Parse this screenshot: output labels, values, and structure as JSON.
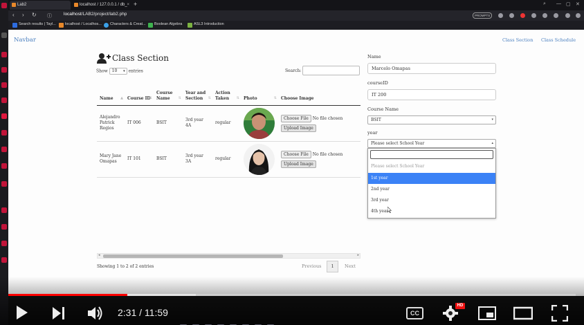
{
  "browser": {
    "tabs": [
      {
        "label": "Lab2",
        "active": true
      },
      {
        "label": "localhost / 127.0.0.1 / db_",
        "active": false
      }
    ],
    "url_host": "localhost",
    "url_path": "/LAB2/project/lab2.php",
    "bookmarks": [
      {
        "label": "Search results | Tayl...",
        "color": "#2d6cdf"
      },
      {
        "label": "localhost / Localhos...",
        "color": "#e8882a"
      },
      {
        "label": "Characters & Creat...",
        "color": "#3aa0e8"
      },
      {
        "label": "Boolean Algebra",
        "color": "#3fb34f"
      },
      {
        "label": "ASL3 Introduction",
        "color": "#7cb342"
      }
    ],
    "promo_badge": "PROMPTS"
  },
  "navbar": {
    "brand": "Navbar",
    "links": [
      "Class Section",
      "Class Schedule"
    ]
  },
  "section": {
    "title": "Class Section",
    "icon": "user-plus-icon",
    "show_label": "Show",
    "entries_value": "10",
    "entries_label": "entries",
    "search_label": "Search:"
  },
  "table": {
    "columns": [
      "Name",
      "Course ID",
      "Course Name",
      "Year and Section",
      "Action Taken",
      "Photo",
      "Choose Image"
    ],
    "rows": [
      {
        "name": "Alejandro Patrick Regios",
        "course_id": "IT 006",
        "course_name": "BSIT",
        "year_section": "3rd year 4A",
        "action": "regular"
      },
      {
        "name": "Mary Jane Omapas",
        "course_id": "IT 101",
        "course_name": "BSIT",
        "year_section": "3rd year 3A",
        "action": "regular"
      }
    ],
    "choose_file_label": "Choose File",
    "no_file_label": "No file chosen",
    "upload_label": "Upload Image",
    "info": "Showing 1 to 2 of 2 entries",
    "pagination": {
      "previous": "Previous",
      "current": "1",
      "next": "Next"
    }
  },
  "form": {
    "name_label": "Name",
    "name_value": "Marcelo Omapas",
    "courseid_label": "courseID",
    "courseid_value": "IT 200",
    "coursename_label": "Course Name",
    "coursename_value": "BSIT",
    "year_label": "year",
    "year_value": "Please select School Year",
    "year_options": [
      "Please select School Year",
      "1st year",
      "2nd year",
      "3rd year",
      "4th year"
    ],
    "highlighted_option": "1st year"
  },
  "player": {
    "time": "2:31 / 11:59",
    "played_fraction": 0.21,
    "buffered_fraction": 0.33,
    "cc_label": "CC",
    "hd_badge": "HD",
    "accent": "#ff0000"
  }
}
